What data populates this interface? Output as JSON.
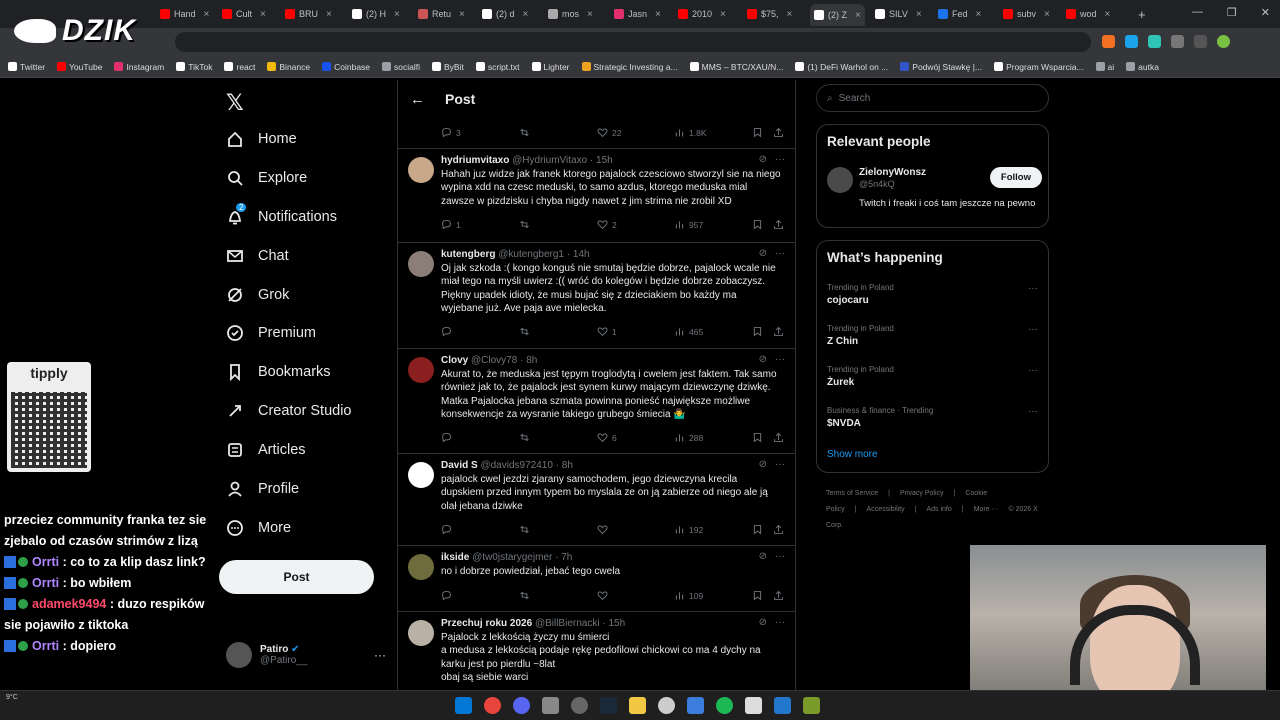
{
  "browser": {
    "tabs": [
      {
        "label": "Hand",
        "color": "#ff0000"
      },
      {
        "label": "Cult",
        "color": "#ff0000"
      },
      {
        "label": "BRU",
        "color": "#ff0000"
      },
      {
        "label": "(2) H",
        "color": "#ffffff"
      },
      {
        "label": "Retu",
        "color": "#cc5555"
      },
      {
        "label": "(2) d",
        "color": "#ffffff"
      },
      {
        "label": "mos",
        "color": "#aaaaaa"
      },
      {
        "label": "Jasn",
        "color": "#e1306c"
      },
      {
        "label": "2010",
        "color": "#ff0000"
      },
      {
        "label": "$75,",
        "color": "#ff0000"
      },
      {
        "label": "(2) Z",
        "color": "#ffffff"
      },
      {
        "label": "SILV",
        "color": "#ffffff"
      },
      {
        "label": "Fed",
        "color": "#1a73e8"
      },
      {
        "label": "subv",
        "color": "#ff0000"
      },
      {
        "label": "wod",
        "color": "#ff0000"
      }
    ],
    "new_tab": "+",
    "window_controls": [
      "—",
      "❐",
      "✕"
    ],
    "bookmarks": [
      {
        "label": "Twitter",
        "color": "#ffffff"
      },
      {
        "label": "YouTube",
        "color": "#ff0000"
      },
      {
        "label": "Instagram",
        "color": "#e1306c"
      },
      {
        "label": "TikTok",
        "color": "#ffffff"
      },
      {
        "label": "react",
        "color": "#ffffff"
      },
      {
        "label": "Binance",
        "color": "#f0b90b"
      },
      {
        "label": "Coinbase",
        "color": "#1652f0"
      },
      {
        "label": "socialfi",
        "color": "#9aa0a6"
      },
      {
        "label": "ByBit",
        "color": "#ffffff"
      },
      {
        "label": "script.txt",
        "color": "#ffffff"
      },
      {
        "label": "Lighter",
        "color": "#ffffff"
      },
      {
        "label": "Strategic Investing a...",
        "color": "#f0a020"
      },
      {
        "label": "MMS – BTC/XAU/N...",
        "color": "#ffffff"
      },
      {
        "label": "(1) DeFi Warhol on ...",
        "color": "#ffffff"
      },
      {
        "label": "Podwój Stawkę |...",
        "color": "#3355cc"
      },
      {
        "label": "Program Wsparcia...",
        "color": "#ffffff"
      },
      {
        "label": "ai",
        "color": "#9aa0a6"
      },
      {
        "label": "autka",
        "color": "#9aa0a6"
      }
    ]
  },
  "overlay": {
    "logo_text": "DZIK",
    "tipply_text": "tipply",
    "chat": [
      {
        "user": "",
        "text": "przeciez community franka tez sie zjebalo od czasów strimów z lizą"
      },
      {
        "user": "Orrti",
        "text": "co to za klip dasz link?"
      },
      {
        "user": "Orrti",
        "text": "bo wbiłem"
      },
      {
        "user": "adamek9494",
        "text": "duzo respików sie pojawiło z tiktoka"
      },
      {
        "user": "Orrti",
        "text": "dopiero"
      }
    ],
    "temp": "9°C"
  },
  "nav": {
    "items": [
      {
        "label": "Home",
        "icon": "home-icon"
      },
      {
        "label": "Explore",
        "icon": "search-icon"
      },
      {
        "label": "Notifications",
        "icon": "bell-icon",
        "badge": "2"
      },
      {
        "label": "Chat",
        "icon": "mail-icon"
      },
      {
        "label": "Grok",
        "icon": "grok-icon"
      },
      {
        "label": "Premium",
        "icon": "premium-icon"
      },
      {
        "label": "Bookmarks",
        "icon": "bookmark-icon"
      },
      {
        "label": "Creator Studio",
        "icon": "rocket-icon"
      },
      {
        "label": "Articles",
        "icon": "article-icon"
      },
      {
        "label": "Profile",
        "icon": "person-icon"
      },
      {
        "label": "More",
        "icon": "more-circle-icon"
      }
    ],
    "post_button": "Post",
    "account": {
      "name": "Patiro",
      "handle": "@Patiro__",
      "more": "···"
    }
  },
  "timeline": {
    "header_title": "Post",
    "top_actions": {
      "replies": "3",
      "likes": "22",
      "views": "1.8K"
    },
    "tweets": [
      {
        "name": "hydriumvitaxo",
        "handle": "@HydriumVitaxo",
        "time": "15h",
        "text": "Hahah juz widze jak franek ktorego pajalock czesciowo stworzyl sie na niego wypina xdd na czesc meduski, to samo azdus, ktorego meduska mial zawsze w pizdzisku i chyba nigdy nawet z jim strima nie zrobil XD",
        "replies": "1",
        "likes": "2",
        "views": "957",
        "avatar": "#c9a88a"
      },
      {
        "name": "kutengberg",
        "handle": "@kutengberg1",
        "time": "14h",
        "text": "Oj jak szkoda :( kongo konguś nie smutaj będzie dobrze, pajalock wcale nie miał tego na myśli uwierz :(( wróć do kolegów i będzie dobrze zobaczysz. Piękny upadek idioty, że musi bujać się z dzieciakiem bo każdy ma wyjebane już. Ave paja ave mielecka.",
        "replies": "",
        "likes": "1",
        "views": "465",
        "avatar": "#8b7d77"
      },
      {
        "name": "Clovy",
        "handle": "@Clovy78",
        "time": "8h",
        "text": "Akurat to, że meduska jest tępym troglodytą i cwelem jest faktem. Tak samo również jak to, że pajalock jest synem kurwy mającym dziewczynę dziwkę. Matka Pajalocka jebana szmata powinna ponieść największe możliwe konsekwencje za wysranie takiego grubego śmiecia 🤷‍♂️",
        "replies": "",
        "likes": "6",
        "views": "288",
        "avatar": "#8b1e1e"
      },
      {
        "name": "David S",
        "handle": "@davids972410",
        "time": "8h",
        "text": "pajalock cwel jezdzi zjarany samochodem, jego dziewczyna krecila dupskiem przed innym typem bo myslala ze on ją zabierze od niego ale ją olał jebana dziwke",
        "replies": "",
        "likes": "",
        "views": "192",
        "avatar": "#ffffff"
      },
      {
        "name": "ikside",
        "handle": "@tw0jstarygejmer",
        "time": "7h",
        "text": "no i dobrze powiedział, jebać tego cwela",
        "replies": "",
        "likes": "",
        "views": "109",
        "avatar": "#6e6b3d"
      },
      {
        "name": "Przechuj roku 2026",
        "handle": "@BillBiernacki",
        "time": "15h",
        "text": "Pajalock z lekkością życzy mu śmierci\na medusa z lekkością podaje rękę pedofilowi chickowi co ma 4 dychy na karku jest po pierdlu ~8lat\nobaj są siebie warci",
        "replies": "",
        "likes": "",
        "views": "",
        "avatar": "#b9b0a6"
      }
    ]
  },
  "right": {
    "search_placeholder": "Search",
    "relevant_title": "Relevant people",
    "person": {
      "name": "ZielonyWonsz",
      "handle": "@5n4kQ",
      "bio": "Twitch i freaki i coś tam jeszcze na pewno",
      "follow": "Follow"
    },
    "happening_title": "What’s happening",
    "trends": [
      {
        "context": "Trending in Poland",
        "name": "cojocaru"
      },
      {
        "context": "Trending in Poland",
        "name": "Z Chin"
      },
      {
        "context": "Trending in Poland",
        "name": "Żurek"
      },
      {
        "context": "Business & finance · Trending",
        "name": "$NVDA"
      }
    ],
    "show_more": "Show more",
    "footer": [
      "Terms of Service",
      "|",
      "Privacy Policy",
      "|",
      "Cookie Policy",
      "|",
      "Accessibility",
      "|",
      "Ads info",
      "|",
      "More ···",
      "© 2026 X Corp."
    ]
  },
  "colors": {
    "accent": "#1d9bf0",
    "background": "#000000",
    "border": "#2f3336",
    "muted": "#71767b"
  }
}
